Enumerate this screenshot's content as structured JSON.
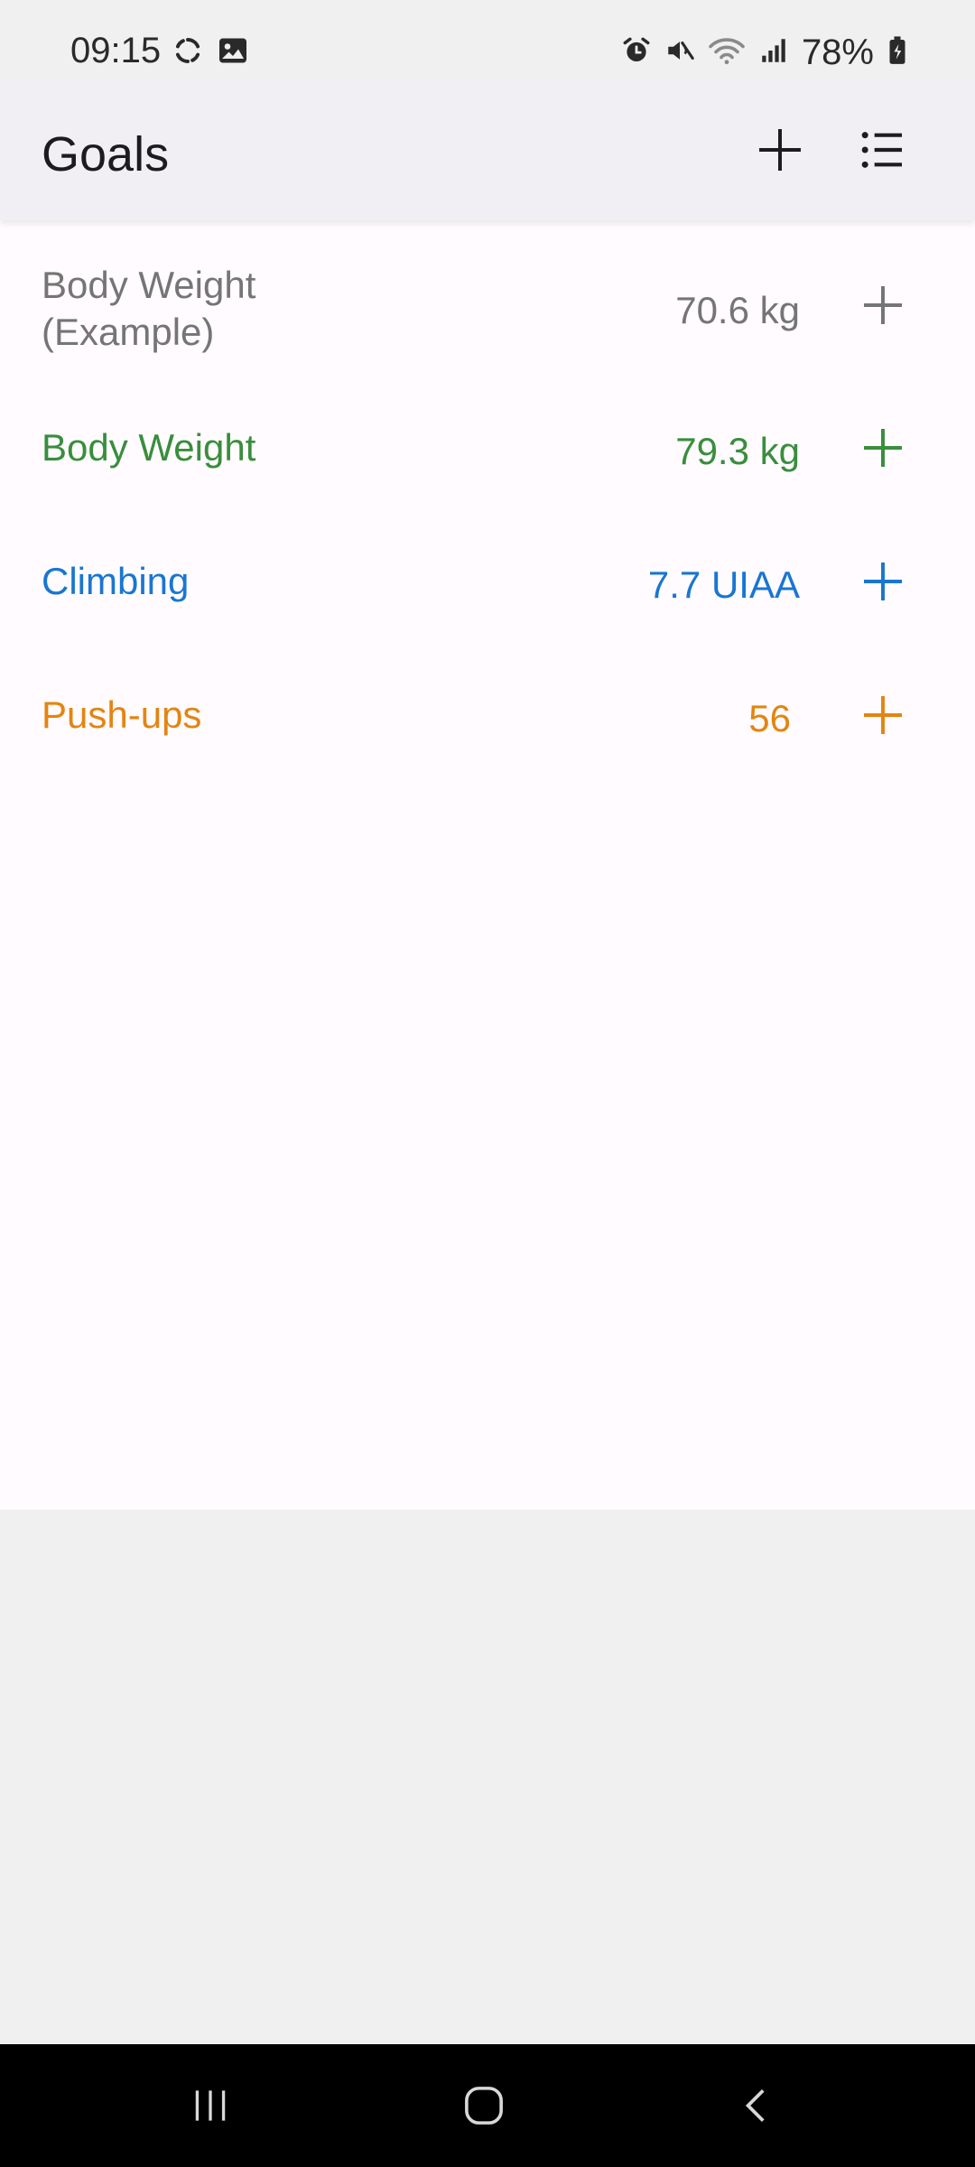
{
  "status_bar": {
    "time": "09:15",
    "battery": "78%",
    "left_icons": [
      "sync-icon",
      "image-icon"
    ],
    "right_icons": [
      "alarm-icon",
      "mute-icon",
      "wifi-icon",
      "signal-icon",
      "battery-icon"
    ]
  },
  "app_bar": {
    "title": "Goals",
    "actions": [
      "add-icon",
      "list-icon"
    ]
  },
  "goals": [
    {
      "name": "Body Weight (Example)",
      "value": "70.6 kg",
      "color": "#757575"
    },
    {
      "name": "Body Weight",
      "value": "79.3 kg",
      "color": "#388e3c"
    },
    {
      "name": "Climbing",
      "value": "7.7 UIAA",
      "color": "#1976d2"
    },
    {
      "name": "Push-ups",
      "value": "56",
      "color": "#e38512"
    }
  ],
  "colors": {
    "status_background": "#f1f0f1",
    "app_bar_background": "#f1eff3",
    "content_background": "#fffbfe",
    "nav_background": "#000000"
  },
  "nav_bar": {
    "buttons": [
      "recent-apps-icon",
      "home-icon",
      "back-icon"
    ]
  }
}
